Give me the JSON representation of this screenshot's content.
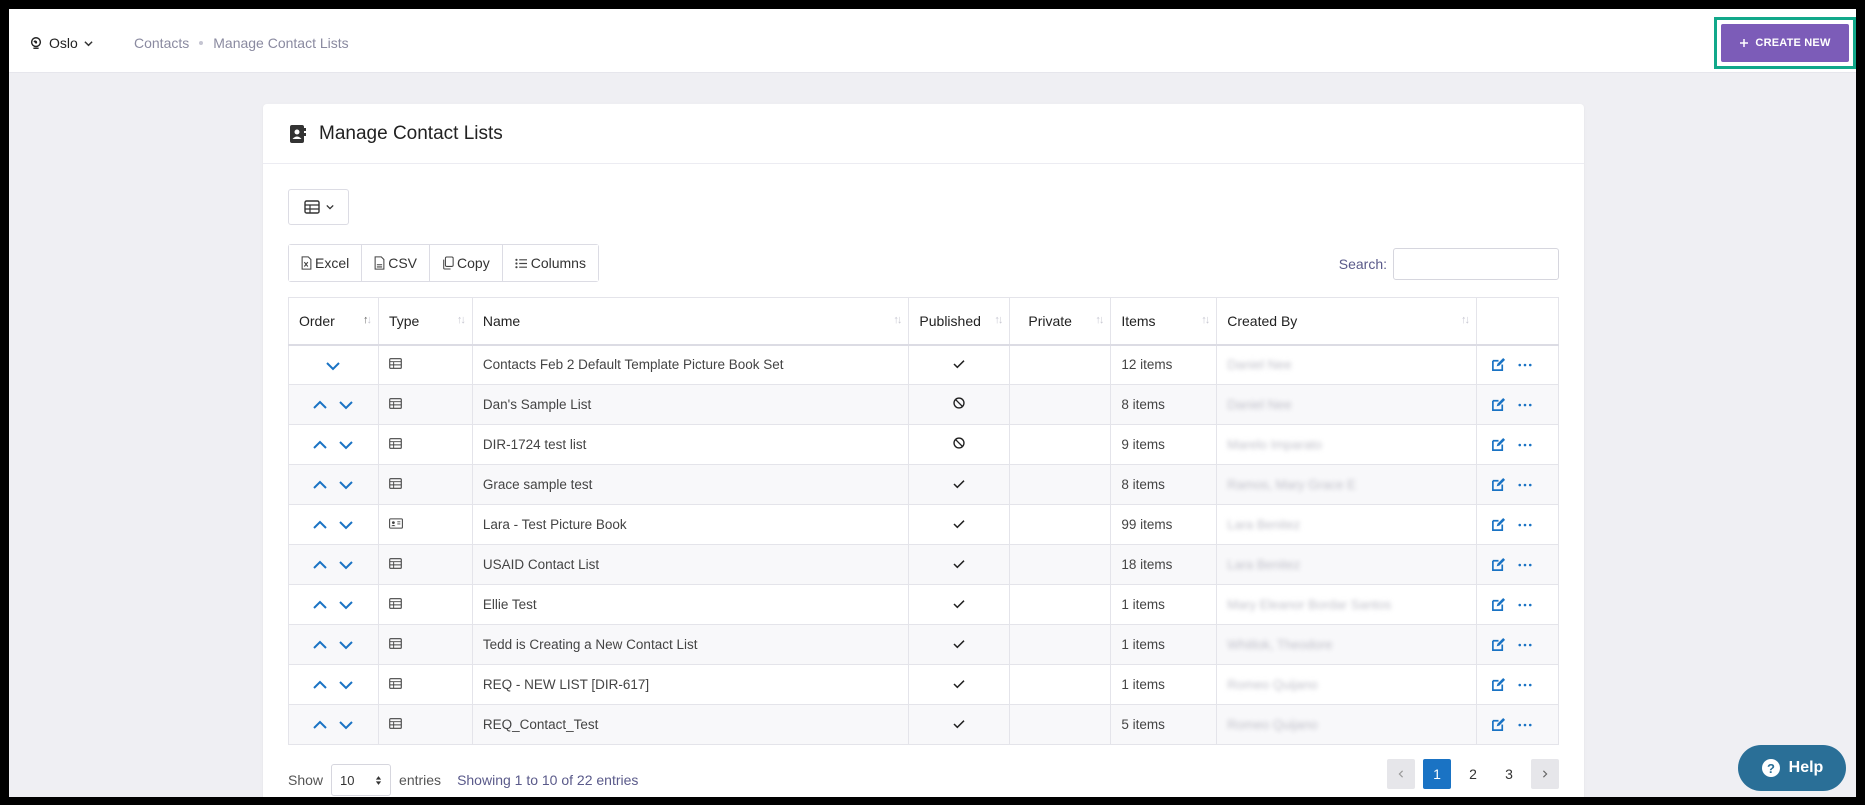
{
  "topbar": {
    "org_name": "Oslo",
    "breadcrumb": [
      "Contacts",
      "Manage Contact Lists"
    ],
    "create_label": "CREATE NEW"
  },
  "card": {
    "title": "Manage Contact Lists"
  },
  "toolbar": {
    "buttons": [
      "Excel",
      "CSV",
      "Copy",
      "Columns"
    ],
    "search_label": "Search:",
    "search_value": ""
  },
  "table": {
    "headers": [
      "Order",
      "Type",
      "Name",
      "Published",
      "Private",
      "Items",
      "Created By",
      ""
    ],
    "rows": [
      {
        "type": "table",
        "name": "Contacts Feb 2 Default Template Picture Book Set",
        "published": "check",
        "items": "12 items",
        "created_by": "Daniel Nee",
        "up": false
      },
      {
        "type": "table",
        "name": "Dan's Sample List",
        "published": "ban",
        "items": "8 items",
        "created_by": "Daniel Nee",
        "up": true
      },
      {
        "type": "table",
        "name": "DIR-1724 test list",
        "published": "ban",
        "items": "9 items",
        "created_by": "Marelo Imparato",
        "up": true
      },
      {
        "type": "table",
        "name": "Grace sample test",
        "published": "check",
        "items": "8 items",
        "created_by": "Ramos, Mary Grace E",
        "up": true
      },
      {
        "type": "card",
        "name": "Lara - Test Picture Book",
        "published": "check",
        "items": "99 items",
        "created_by": "Lara Benitez",
        "up": true
      },
      {
        "type": "table",
        "name": "USAID Contact List",
        "published": "check",
        "items": "18 items",
        "created_by": "Lara Benitez",
        "up": true
      },
      {
        "type": "table",
        "name": "Ellie Test",
        "published": "check",
        "items": "1 items",
        "created_by": "Mary Eleanor Bordar Santos",
        "up": true
      },
      {
        "type": "table",
        "name": "Tedd is Creating a New Contact List",
        "published": "check",
        "items": "1 items",
        "created_by": "Whitlok, Theodore",
        "up": true
      },
      {
        "type": "table",
        "name": "REQ - NEW LIST [DIR-617]",
        "published": "check",
        "items": "1 items",
        "created_by": "Romeo Quijano",
        "up": true
      },
      {
        "type": "table",
        "name": "REQ_Contact_Test",
        "published": "check",
        "items": "5 items",
        "created_by": "Romeo Quijano",
        "up": true
      }
    ]
  },
  "footer": {
    "show_label": "Show",
    "page_length": "10",
    "entries_label": "entries",
    "info": "Showing 1 to 10 of 22 entries",
    "pages": [
      "1",
      "2",
      "3"
    ],
    "active_page": "1"
  },
  "help_label": "Help",
  "colors": {
    "accent": "#7c5cb8",
    "highlight": "#11a88a",
    "link": "#1a73c4",
    "help": "#2a6f97"
  }
}
